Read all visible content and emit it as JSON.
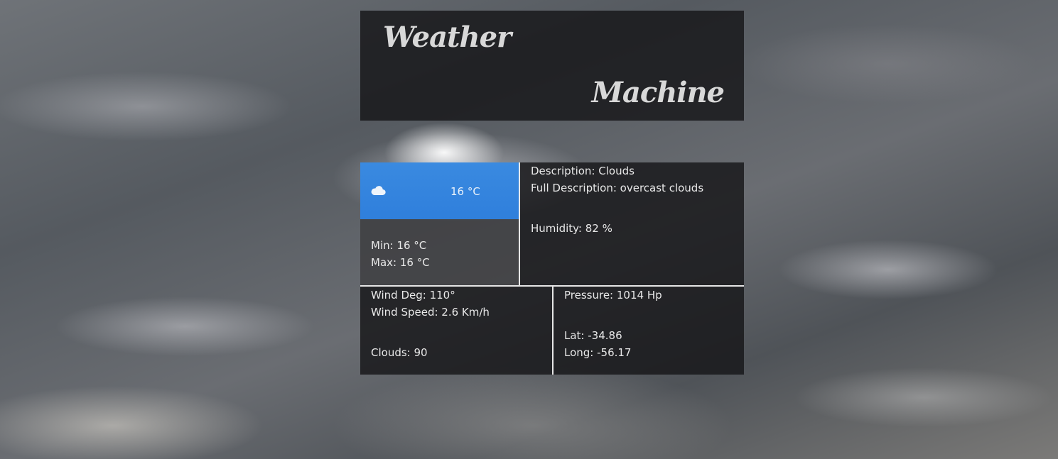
{
  "header": {
    "title_word_1": "Weather",
    "title_word_2": "Machine"
  },
  "current": {
    "icon": "cloud-icon",
    "temperature": "16 °C",
    "min": "Min: 16 °C",
    "max": "Max: 16 °C"
  },
  "details": {
    "description": "Description: Clouds",
    "full_description": "Full Description: overcast clouds",
    "humidity": "Humidity: 82 %"
  },
  "wind": {
    "deg": "Wind Deg: 110°",
    "speed": "Wind Speed: 2.6 Km/h",
    "clouds": "Clouds: 90"
  },
  "location": {
    "pressure": "Pressure: 1014 Hp",
    "lat": "Lat: -34.86",
    "long": "Long: -56.17"
  },
  "colors": {
    "accent": "#2f7fdc",
    "panel": "#161618",
    "text": "#e8e8e8"
  }
}
